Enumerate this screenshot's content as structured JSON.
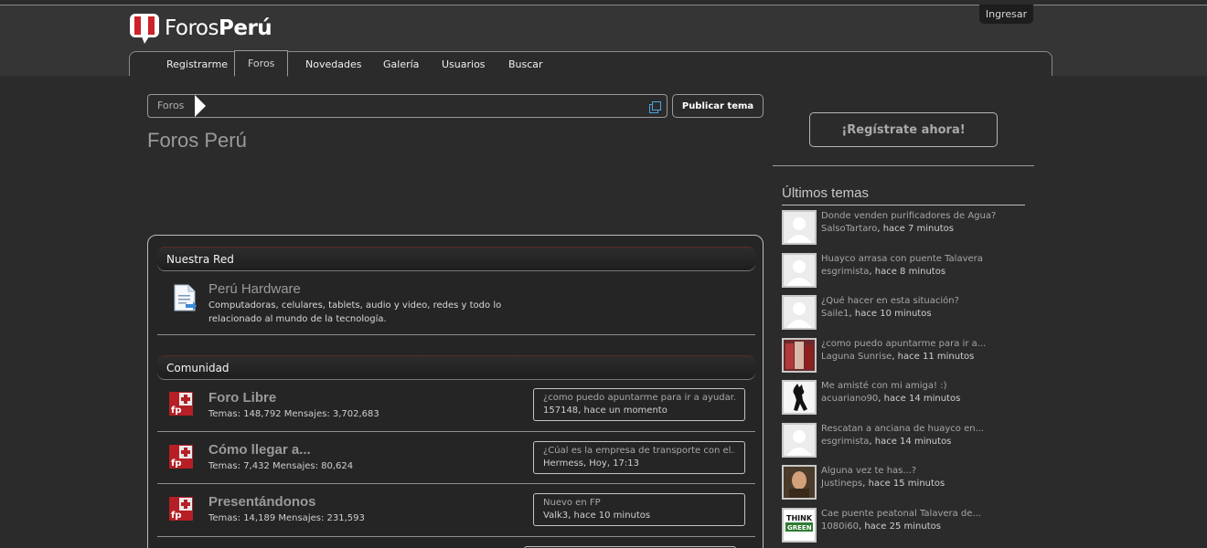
{
  "brand": {
    "name_regular": "Foros",
    "name_bold": "Perú",
    "colors": {
      "accent": "#cc2229",
      "background": "#2b2b2b"
    }
  },
  "header": {
    "login_label": "Ingresar"
  },
  "nav": {
    "tabs": [
      {
        "label": "Registrarme"
      },
      {
        "label": "Foros"
      },
      {
        "label": "Novedades"
      },
      {
        "label": "Galería"
      },
      {
        "label": "Usuarios"
      },
      {
        "label": "Buscar"
      }
    ]
  },
  "breadcrumb": {
    "home": "Foros"
  },
  "actions": {
    "publish_label": "Publicar tema"
  },
  "page": {
    "title": "Foros Perú"
  },
  "categories": [
    {
      "title": "Nuestra Red",
      "forums": [
        {
          "title": "Perú Hardware",
          "desc": "Computadoras, celulares, tablets, audio y video, redes y todo lo relacionado al mundo de la tecnología."
        }
      ]
    },
    {
      "title": "Comunidad",
      "forums": [
        {
          "title": "Foro Libre",
          "stats": "Temas: 148,792 Mensajes: 3,702,683",
          "last_title": "¿como puedo apuntarme para ir a ayudar...",
          "last_user": "157148",
          "last_time": "hace un momento"
        },
        {
          "title": "Cómo llegar a...",
          "stats": "Temas: 7,432 Mensajes: 80,624",
          "last_title": "¿Cúal es la empresa de transporte con el...",
          "last_user": "Hermess",
          "last_time": "Hoy, 17:13"
        },
        {
          "title": "Presentándonos",
          "stats": "Temas: 14,189 Mensajes: 231,593",
          "last_title": "Nuevo en FP",
          "last_user": "Valk3",
          "last_time": "hace 10 minutos"
        }
      ]
    }
  ],
  "sidebar": {
    "register_label": "¡Regístrate ahora!",
    "latest_title": "Últimos temas",
    "topics": [
      {
        "title": "Donde venden purificadores de Agua?",
        "user": "SalsoTartaro",
        "time": "hace 7 minutos",
        "avatar": "default"
      },
      {
        "title": "Huayco arrasa con puente Talavera",
        "user": "esgrimista",
        "time": "hace 8 minutos",
        "avatar": "default"
      },
      {
        "title": "¿Qué hacer en esta situación?",
        "user": "Saile1",
        "time": "hace 10 minutos",
        "avatar": "default"
      },
      {
        "title": "¿como puedo apuntarme para ir a...",
        "user": "Laguna Sunrise",
        "time": "hace 11 minutos",
        "avatar": "photo-red"
      },
      {
        "title": "Me amisté con mi amiga! :)",
        "user": "acuariano90",
        "time": "hace 14 minutos",
        "avatar": "silhouette"
      },
      {
        "title": "Rescatan a anciana de huayco en...",
        "user": "esgrimista",
        "time": "hace 14 minutos",
        "avatar": "default"
      },
      {
        "title": "Alguna vez te has...?",
        "user": "Justineps",
        "time": "hace 15 minutos",
        "avatar": "photo-warm"
      },
      {
        "title": "Cae puente peatonal Talavera de...",
        "user": "1080i60",
        "time": "hace 25 minutos",
        "avatar": "think-green"
      }
    ]
  }
}
